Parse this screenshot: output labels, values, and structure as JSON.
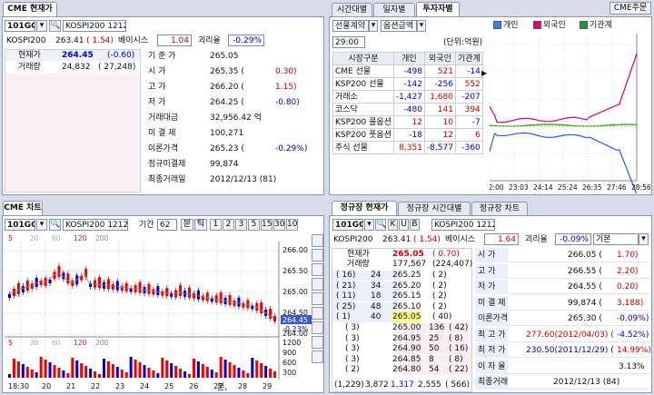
{
  "tl": {
    "tab": "CME 현재가",
    "code": "101GC",
    "name": "KOSPI200 1212",
    "row2_label": "KOSPI200",
    "row2_val": "263.41",
    "row2_chg": "( 1.54)",
    "basis_label": "베이시스",
    "basis_val": "1.04",
    "gap_label": "괴리율",
    "gap_val": "-0.29%",
    "cur_label": "현재가",
    "cur_val": "264.45",
    "cur_chg": "(-0.60)",
    "vol_label": "거래량",
    "vol_val": "24,832",
    "vol_chg": "( 27,248)",
    "rows": [
      {
        "label": "기 준 가",
        "val": "265.05",
        "chg": "",
        "cls": ""
      },
      {
        "label": "시 가",
        "val": "265.35 (",
        "chg": "0.30)",
        "cls": "red"
      },
      {
        "label": "고 가",
        "val": "266.20 (",
        "chg": "1.15)",
        "cls": "red"
      },
      {
        "label": "저 가",
        "val": "264.25 (",
        "chg": "-0.80)",
        "cls": "blue"
      },
      {
        "label": "거래대금",
        "val": "32,956.42 억",
        "chg": "",
        "cls": ""
      },
      {
        "label": "미 결 제",
        "val": "100,271",
        "chg": "",
        "cls": ""
      },
      {
        "label": "이론가격",
        "val": "265.23 (",
        "chg": "-0.29%)",
        "cls": "blue"
      },
      {
        "label": "정규미결제",
        "val": "99,874",
        "chg": "",
        "cls": ""
      },
      {
        "label": "최종거래일",
        "val": "2012/12/13 (81)",
        "chg": "",
        "cls": ""
      }
    ]
  },
  "tr": {
    "tabs": [
      "시간대별",
      "일자별",
      "투자자별"
    ],
    "order_btn": "CME주문",
    "combo1": "선물계약",
    "combo2": "옵션금액",
    "time": "29:00",
    "unit": "(단위:억원)",
    "legend": [
      "개인",
      "외국인",
      "기관계"
    ],
    "headers": [
      "시장구분",
      "개인",
      "외국인",
      "기관계"
    ],
    "rows": [
      [
        "CME 선물",
        "-498",
        "521",
        "-14"
      ],
      [
        "KSP200 선물",
        "-142",
        "-256",
        "552"
      ],
      [
        "거래소",
        "-1,427",
        "1,680",
        "-207"
      ],
      [
        "코스닥",
        "-480",
        "141",
        "394"
      ],
      [
        "KSP200 콜옵션",
        "12",
        "10",
        "-7"
      ],
      [
        "KSP200 풋옵션",
        "-18",
        "12",
        "6"
      ],
      [
        "주식 선물",
        "8,351",
        "-8,577",
        "-360"
      ]
    ],
    "xticks": [
      "22:00",
      "23:03",
      "24:14",
      "25:24",
      "26:35",
      "27:46",
      "28:56"
    ]
  },
  "bl": {
    "tab": "CME 차트",
    "code": "101GC",
    "name": "KOSPI200 1212",
    "period_label": "기간",
    "period_val": "62",
    "btn_day": "분",
    "btn_tick": "틱",
    "nums": [
      "1",
      "2",
      "3",
      "5",
      "15",
      "30",
      "10"
    ],
    "ma_legend": [
      "5",
      "20",
      "60",
      "120",
      "200"
    ],
    "vol_legend": [
      "5",
      "20",
      "60",
      "120",
      "200"
    ],
    "prices": [
      "266.00",
      "265.50",
      "265.00",
      "264.50",
      "264.00"
    ],
    "cur_price": "264.45",
    "cur_pct": "-0.23%",
    "vols": [
      "1200",
      "900",
      "600",
      "300"
    ],
    "xticks": [
      "18:30",
      "20",
      "21",
      "22",
      "23",
      "24",
      "25",
      "26",
      "27",
      "28",
      "29"
    ],
    "bottom": "분,"
  },
  "br": {
    "tabs": [
      "정규장 현재가",
      "정규장 시간대별",
      "정규장 차트"
    ],
    "code": "101GC",
    "name": "KOSPI200 1212",
    "k_label": "KOSPI200",
    "k_val": "263.41",
    "k_chg": "( 1.54)",
    "basis_label": "베이시스",
    "basis_val": "1.64",
    "gap_label": "괴리율",
    "gap_val": "-0.09%",
    "mode": "기본",
    "cur_label": "현재가",
    "cur_val": "265.05",
    "cur_chg": "( 0.70)",
    "vol_label": "거래량",
    "vol_val": "177,567",
    "vol_chg": "(224,407)",
    "asks": [
      [
        "( 16)",
        "24",
        "265.25",
        "( 2)"
      ],
      [
        "( 21)",
        "34",
        "265.20",
        "( 2)"
      ],
      [
        "( 11)",
        "18",
        "265.15",
        "( 2)"
      ],
      [
        "( 25)",
        "48",
        "265.10",
        "( 2)"
      ],
      [
        "( 1)",
        "40",
        "265.05",
        "( 40)"
      ]
    ],
    "bids": [
      [
        "( 3)",
        "265.00",
        "136",
        "( 42)"
      ],
      [
        "( 3)",
        "264.95",
        "25",
        "( 8)"
      ],
      [
        "( 3)",
        "264.90",
        "50",
        "( 16)"
      ],
      [
        "( 3)",
        "264.85",
        "8",
        "( 8)"
      ],
      [
        "( 2)",
        "264.80",
        "54",
        "( 22)"
      ]
    ],
    "total": [
      "(1,229)",
      "3,872",
      "1,317",
      "2,555",
      "( 566)"
    ],
    "info": [
      {
        "label": "시 가",
        "val": "266.05 (",
        "chg": "1.70)",
        "cls": "red"
      },
      {
        "label": "고 가",
        "val": "266.55 (",
        "chg": "2.20)",
        "cls": "red"
      },
      {
        "label": "저 가",
        "val": "264.55 (",
        "chg": "0.20)",
        "cls": "red"
      },
      {
        "label": "미 결 제",
        "val": "99,874 (",
        "chg": "3,188)",
        "cls": "red"
      },
      {
        "label": "이론가격",
        "val": "265.30 (",
        "chg": "-0.09%)",
        "cls": "blue"
      },
      {
        "label": "최 고 가",
        "val": "277.60(2012/04/03) (",
        "chg": "-4.52%)",
        "cls": "blue"
      },
      {
        "label": "최 저 가",
        "val": "230.50(2011/12/29) (",
        "chg": "14.99%)",
        "cls": "red"
      },
      {
        "label": "이 자 율",
        "val": "3.13%",
        "chg": "",
        "cls": ""
      },
      {
        "label": "최종거래",
        "val": "2012/12/13 (84)",
        "chg": "",
        "cls": ""
      }
    ]
  }
}
